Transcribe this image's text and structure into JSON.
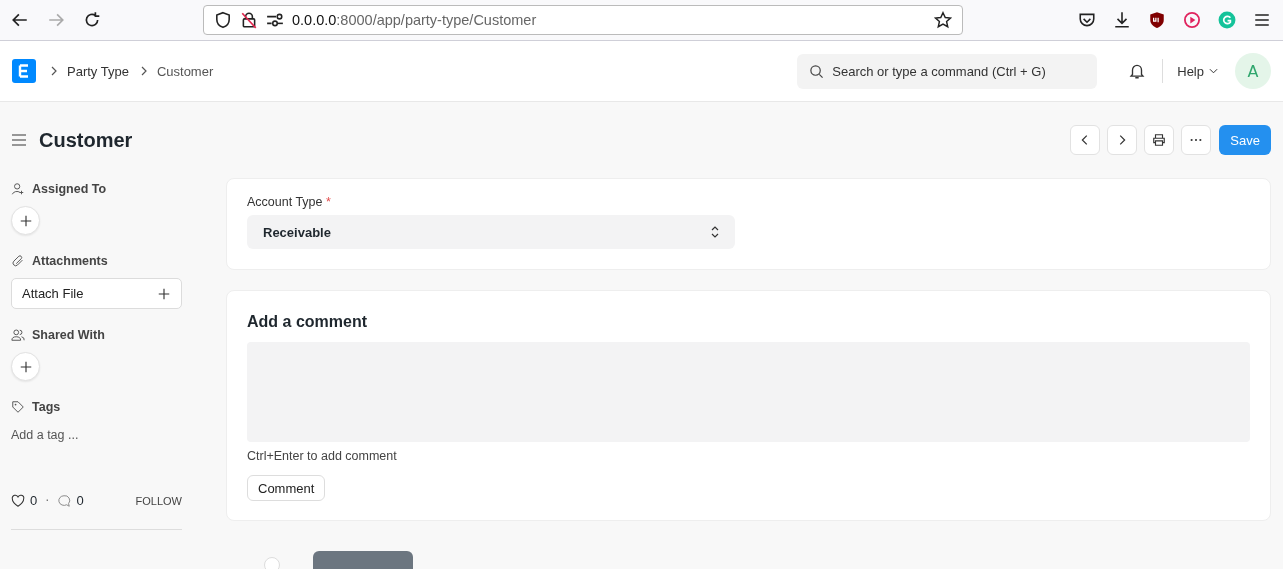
{
  "browser": {
    "url_host": "0.0.0.0",
    "url_rest": ":8000/app/party-type/Customer"
  },
  "navbar": {
    "breadcrumbs": [
      {
        "label": "Party Type",
        "current": false
      },
      {
        "label": "Customer",
        "current": true
      }
    ],
    "search": {
      "placeholder": "Search or type a command (Ctrl + G)"
    },
    "help": "Help",
    "avatar": "A"
  },
  "page": {
    "title": "Customer",
    "actions": [
      {
        "kind": "prev"
      },
      {
        "kind": "next"
      },
      {
        "kind": "print"
      },
      {
        "kind": "more"
      }
    ],
    "primary": "Save"
  },
  "sidebar": {
    "sections": [
      {
        "kind": "assign",
        "title": "Assigned To"
      },
      {
        "kind": "attach",
        "title": "Attachments",
        "button": "Attach File"
      },
      {
        "kind": "share",
        "title": "Shared With"
      },
      {
        "kind": "tags",
        "title": "Tags",
        "placeholder": "Add a tag ..."
      }
    ],
    "likes": "0",
    "separator": "·",
    "comments": "0",
    "follow": "FOLLOW"
  },
  "form": {
    "field": {
      "label": "Account Type",
      "required_mark": "*",
      "value": "Receivable"
    }
  },
  "comment": {
    "title": "Add a comment",
    "hint": "Ctrl+Enter to add comment",
    "button": "Comment"
  }
}
